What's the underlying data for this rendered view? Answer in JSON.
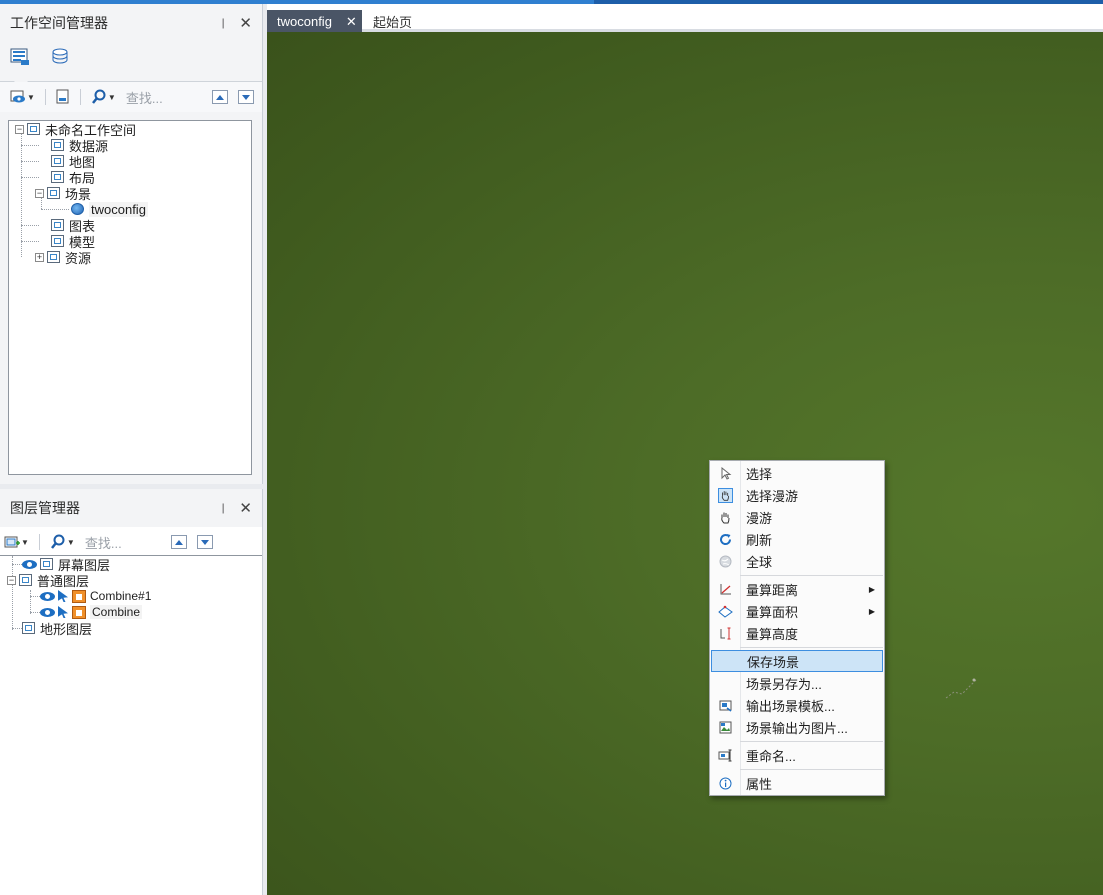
{
  "workspace_panel": {
    "title": "工作空间管理器",
    "pin": "❘",
    "close": "✕",
    "search_placeholder": "查找...",
    "tree": {
      "root": "未命名工作空间",
      "items": [
        "数据源",
        "地图",
        "布局",
        "场景",
        "twoconfig",
        "图表",
        "模型",
        "资源"
      ]
    }
  },
  "layer_panel": {
    "title": "图层管理器",
    "pin": "❘",
    "close": "✕",
    "search_placeholder": "查找...",
    "tree": {
      "screen_layer": "屏幕图层",
      "normal_layer": "普通图层",
      "children": [
        "Combine#1",
        "Combine"
      ],
      "terrain_layer": "地形图层"
    }
  },
  "tabs": [
    {
      "label": "twoconfig",
      "close": "✕"
    },
    {
      "label": "起始页"
    }
  ],
  "context_menu": {
    "items": [
      {
        "label": "选择",
        "icon": "pointer-icon"
      },
      {
        "label": "选择漫游",
        "icon": "hand-select-icon"
      },
      {
        "label": "漫游",
        "icon": "hand-icon"
      },
      {
        "label": "刷新",
        "icon": "refresh-icon"
      },
      {
        "label": "全球",
        "icon": "globe-icon"
      },
      {
        "label": "量算距离",
        "icon": "measure-distance-icon",
        "submenu": true
      },
      {
        "label": "量算面积",
        "icon": "measure-area-icon",
        "submenu": true
      },
      {
        "label": "量算高度",
        "icon": "measure-height-icon"
      },
      {
        "label": "保存场景",
        "highlighted": true
      },
      {
        "label": "场景另存为..."
      },
      {
        "label": "输出场景模板...",
        "icon": "export-template-icon"
      },
      {
        "label": "场景输出为图片...",
        "icon": "export-image-icon"
      },
      {
        "label": "重命名...",
        "icon": "rename-icon"
      },
      {
        "label": "属性",
        "icon": "info-icon"
      }
    ]
  },
  "colors": {
    "accent": "#2f7fd0",
    "scene_green": "#4d6c27",
    "menu_highlight": "#cde4f7",
    "active_tab": "#4a5566"
  }
}
